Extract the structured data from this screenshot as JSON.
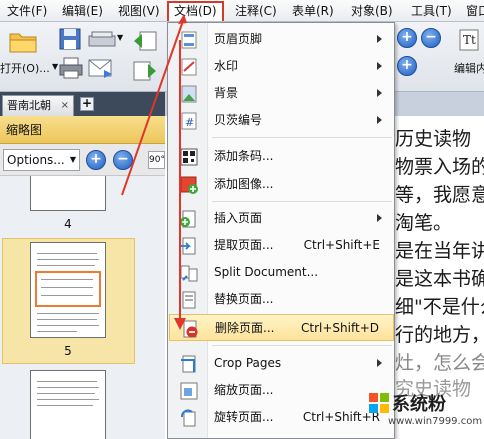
{
  "menubar": {
    "items": [
      "文件(F)",
      "编辑(E)",
      "视图(V)",
      "文档(D)",
      "注释(C)",
      "表单(R)",
      "对象(B)",
      "工具(T)",
      "窗口"
    ]
  },
  "toolbar": {
    "open_label": "打开(O)...",
    "edit_label": "编辑内"
  },
  "tabs": {
    "doc_tab_label": "晋南北朝",
    "close_glyph": "×",
    "new_tab_glyph": "+"
  },
  "thumbnail_panel": {
    "title": "缩略图",
    "options_label": "Options...",
    "rotate_label": "90°",
    "page_numbers": [
      "4",
      "5"
    ]
  },
  "document": {
    "lines": [
      "历史读物",
      "物票入场的",
      "等，我愿意",
      "淘笔。",
      "是在当年讲",
      "是这本书确",
      "细\"不是什么",
      "行的地方，",
      "灶，怎么会",
      "究史读物"
    ]
  },
  "dropdown": {
    "items": [
      {
        "label": "页眉页脚",
        "shortcut": "",
        "submenu": true,
        "icon": "header-footer-icon"
      },
      {
        "label": "水印",
        "shortcut": "",
        "submenu": true,
        "icon": "watermark-icon"
      },
      {
        "label": "背景",
        "shortcut": "",
        "submenu": true,
        "icon": "background-icon"
      },
      {
        "label": "贝茨编号",
        "shortcut": "",
        "submenu": true,
        "icon": "bates-number-icon"
      },
      {
        "label": "添加条码...",
        "shortcut": "",
        "submenu": false,
        "icon": "barcode-icon"
      },
      {
        "label": "添加图像...",
        "shortcut": "",
        "submenu": false,
        "icon": "add-image-icon"
      },
      {
        "label": "插入页面",
        "shortcut": "",
        "submenu": true,
        "icon": "insert-page-icon"
      },
      {
        "label": "提取页面...",
        "shortcut": "Ctrl+Shift+E",
        "submenu": false,
        "icon": "extract-page-icon"
      },
      {
        "label": "Split Document...",
        "shortcut": "",
        "submenu": false,
        "icon": "split-document-icon"
      },
      {
        "label": "替换页面...",
        "shortcut": "",
        "submenu": false,
        "icon": "replace-page-icon"
      },
      {
        "label": "删除页面...",
        "shortcut": "Ctrl+Shift+D",
        "submenu": false,
        "icon": "delete-page-icon"
      },
      {
        "label": "Crop Pages",
        "shortcut": "",
        "submenu": true,
        "icon": "crop-pages-icon"
      },
      {
        "label": "缩放页面...",
        "shortcut": "",
        "submenu": false,
        "icon": "scale-pages-icon"
      },
      {
        "label": "旋转页面...",
        "shortcut": "Ctrl+Shift+R",
        "submenu": false,
        "icon": "rotate-pages-icon"
      }
    ],
    "highlighted_index": 10
  },
  "watermark": {
    "brand": "系统粉",
    "url": "www.win7999.com"
  },
  "colors": {
    "accent_red": "#e0362b",
    "highlight": "#fde39b",
    "thumb_header": "#ecc65a"
  }
}
